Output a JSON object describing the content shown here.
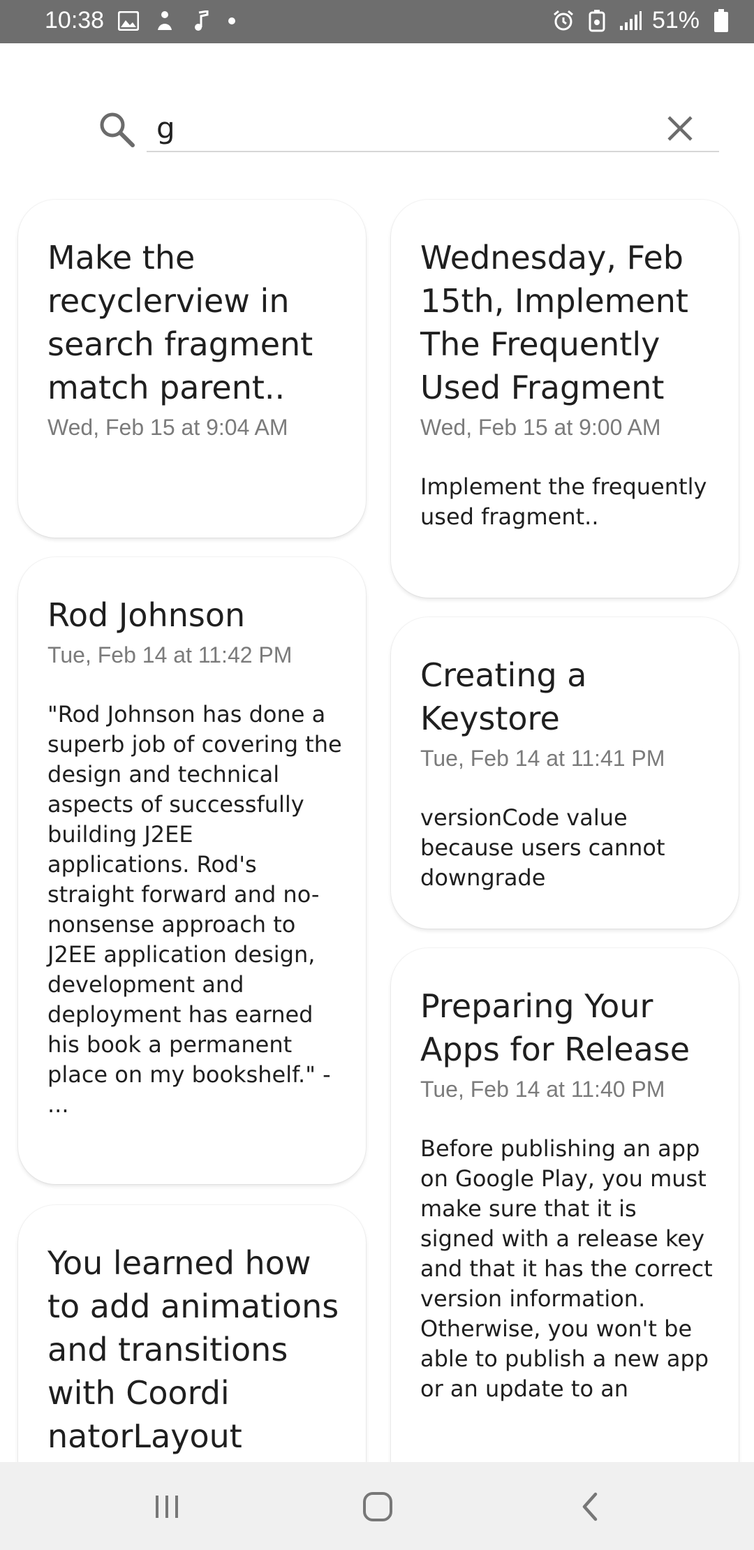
{
  "status_bar": {
    "time": "10:38",
    "battery": "51%",
    "left_icons": [
      "gallery-icon",
      "figure-icon",
      "music-note-icon",
      "dot-icon"
    ],
    "right_icons": [
      "alarm-icon",
      "battery-saver-icon",
      "signal-icon",
      "battery-icon"
    ]
  },
  "search": {
    "value": "g",
    "placeholder": ""
  },
  "notes": [
    {
      "title": "Make the recyclerview in search fragment match parent..",
      "date": "Wed, Feb 15 at 9:04 AM",
      "body": ""
    },
    {
      "title": "Wednesday, Feb 15th, Implement The Frequently Used Fragment",
      "date": "Wed, Feb 15 at 9:00 AM",
      "body": "Implement the frequently used fragment.."
    },
    {
      "title": "Rod Johnson",
      "date": "Tue, Feb 14 at 11:42 PM",
      "body": "\"Rod Johnson has done a superb job of covering the design and technical aspects of successfully building J2EE applications. Rod's straight forward and no-nonsense approach to J2EE application design, development and deployment has earned his book a permanent place on my bookshelf.\" - ..."
    },
    {
      "title": "Creating a Keystore",
      "date": "Tue, Feb 14 at 11:41 PM",
      "body": "versionCode value because users cannot downgrade"
    },
    {
      "title": "Preparing Your Apps for Release",
      "date": "Tue, Feb 14 at 11:40 PM",
      "body": "Before publishing an app on Google Play, you must make sure that it is signed with a release key and that it has the correct version information. Otherwise, you won't be able to publish a new app or an update to an"
    },
    {
      "title": "You learned how to add animations and transitions with Coordi natorLayout",
      "date": "",
      "body": ""
    }
  ],
  "nav": {
    "icons": [
      "recent-apps-icon",
      "home-icon",
      "back-icon"
    ]
  }
}
